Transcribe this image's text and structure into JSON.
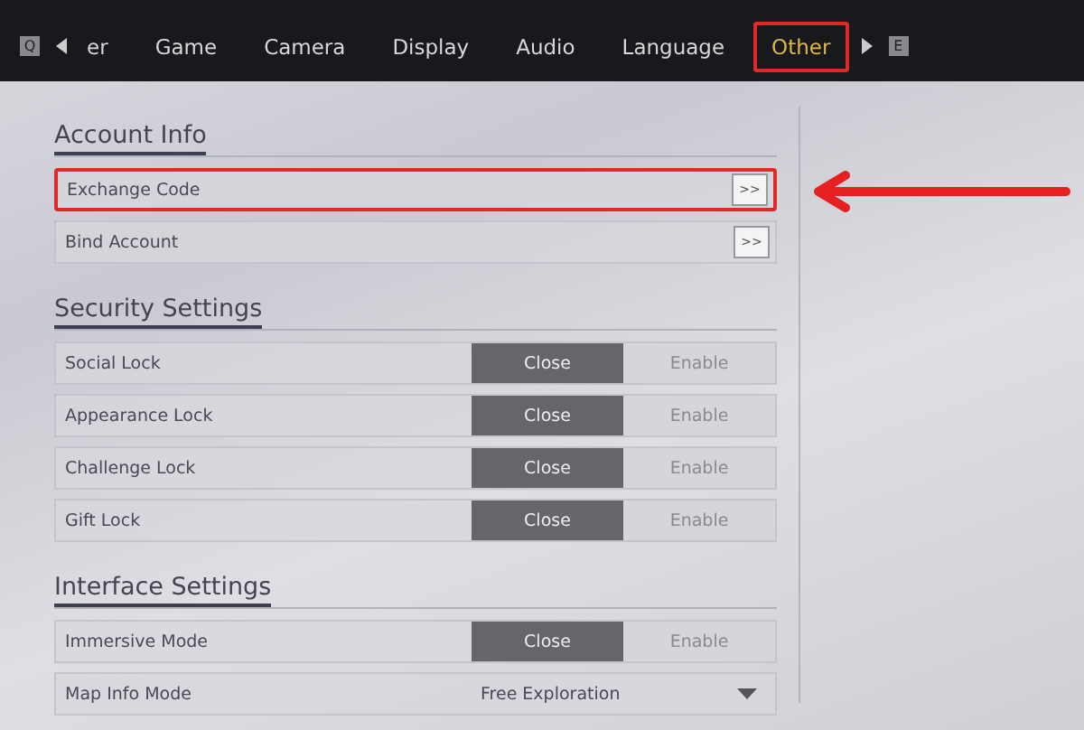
{
  "tab_bar": {
    "left_key": "Q",
    "right_key": "E",
    "tabs": [
      {
        "label": "er",
        "selected": false,
        "highlighted": false
      },
      {
        "label": "Game",
        "selected": false,
        "highlighted": false
      },
      {
        "label": "Camera",
        "selected": false,
        "highlighted": false
      },
      {
        "label": "Display",
        "selected": false,
        "highlighted": false
      },
      {
        "label": "Audio",
        "selected": false,
        "highlighted": false
      },
      {
        "label": "Language",
        "selected": false,
        "highlighted": false
      },
      {
        "label": "Other",
        "selected": true,
        "highlighted": true
      }
    ]
  },
  "sections": [
    {
      "title": "Account Info",
      "rows": [
        {
          "kind": "link",
          "label": "Exchange Code",
          "button": ">>",
          "highlighted": true
        },
        {
          "kind": "link",
          "label": "Bind Account",
          "button": ">>",
          "highlighted": false
        }
      ]
    },
    {
      "title": "Security Settings",
      "rows": [
        {
          "kind": "toggle",
          "label": "Social Lock",
          "highlighted": false,
          "options": [
            {
              "label": "Close",
              "selected": true
            },
            {
              "label": "Enable",
              "selected": false
            }
          ]
        },
        {
          "kind": "toggle",
          "label": "Appearance Lock",
          "highlighted": false,
          "options": [
            {
              "label": "Close",
              "selected": true
            },
            {
              "label": "Enable",
              "selected": false
            }
          ]
        },
        {
          "kind": "toggle",
          "label": "Challenge Lock",
          "highlighted": false,
          "options": [
            {
              "label": "Close",
              "selected": true
            },
            {
              "label": "Enable",
              "selected": false
            }
          ]
        },
        {
          "kind": "toggle",
          "label": "Gift Lock",
          "highlighted": false,
          "options": [
            {
              "label": "Close",
              "selected": true
            },
            {
              "label": "Enable",
              "selected": false
            }
          ]
        }
      ]
    },
    {
      "title": "Interface Settings",
      "rows": [
        {
          "kind": "toggle",
          "label": "Immersive Mode",
          "highlighted": false,
          "options": [
            {
              "label": "Close",
              "selected": true
            },
            {
              "label": "Enable",
              "selected": false
            }
          ]
        },
        {
          "kind": "dropdown",
          "label": "Map Info Mode",
          "highlighted": false,
          "value": "Free Exploration"
        }
      ]
    }
  ]
}
